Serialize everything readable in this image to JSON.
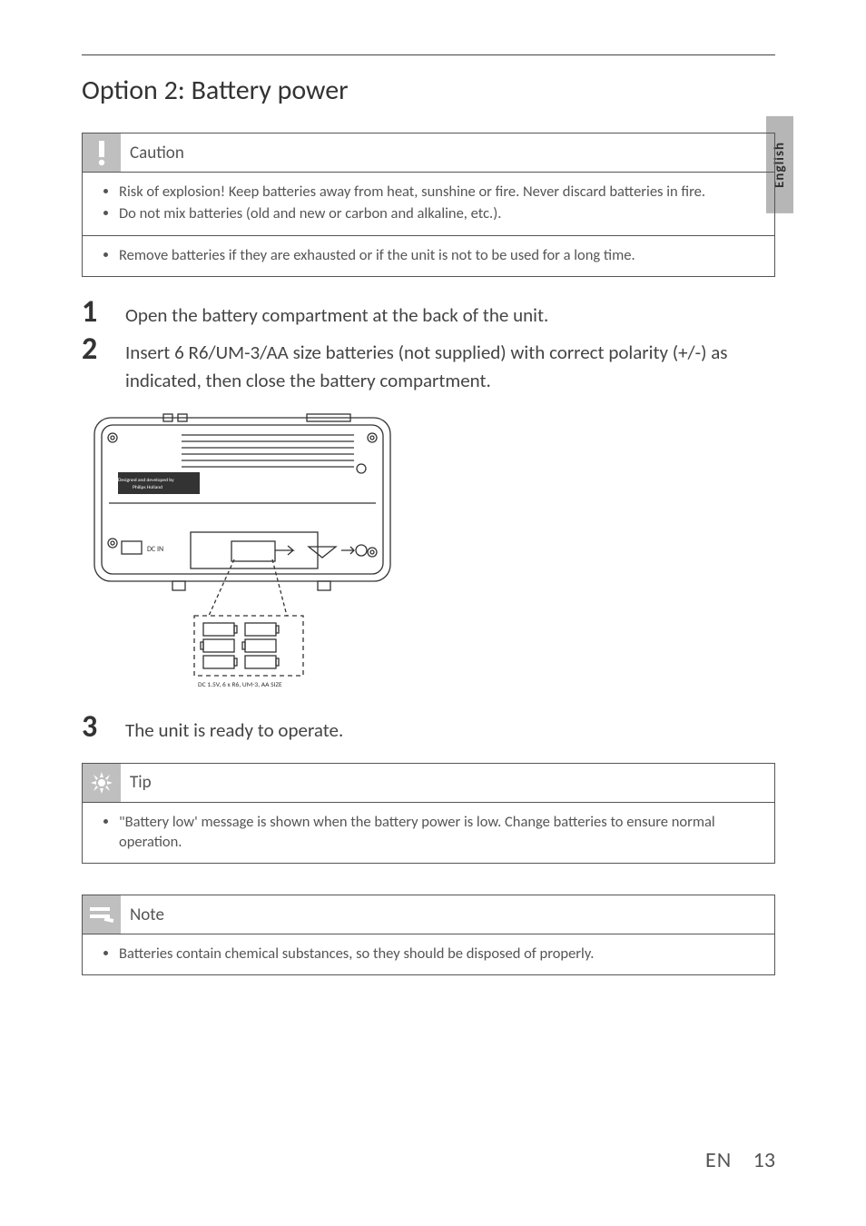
{
  "side_tab": "English",
  "title": "Option 2: Battery power",
  "caution": {
    "label": "Caution",
    "items_a": [
      "Risk of explosion! Keep batteries away from heat, sunshine or fire. Never discard batteries in fire.",
      "Do not mix batteries (old and new or carbon and alkaline, etc.)."
    ],
    "items_b": [
      "Remove batteries if they are exhausted or if the unit is not to be used for a long time."
    ]
  },
  "steps": [
    {
      "n": "1",
      "text": "Open the battery compartment at the back of the unit."
    },
    {
      "n": "2",
      "text": "Insert 6 R6/UM-3/AA size batteries (not supplied) with correct polarity (+/-) as indicated, then close the battery compartment."
    },
    {
      "n": "3",
      "text": "The unit is ready to operate."
    }
  ],
  "illustration_caption": "DC 1.5V, 6 x R6, UM-3, AA SIZE",
  "tip": {
    "label": "Tip",
    "items": [
      "\"Battery low' message is shown when the battery power is low. Change batteries to ensure normal operation."
    ]
  },
  "note": {
    "label": "Note",
    "items": [
      "Batteries contain chemical substances, so they should be disposed of properly."
    ]
  },
  "footer": {
    "lang": "EN",
    "page": "13"
  }
}
